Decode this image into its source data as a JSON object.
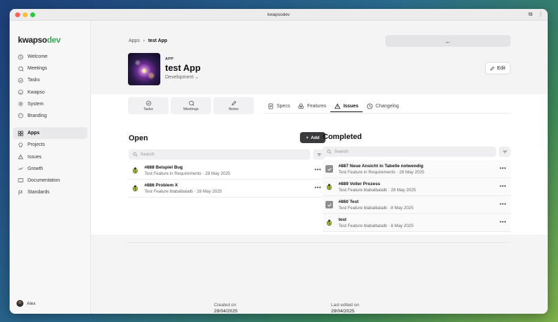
{
  "window": {
    "title": "kwapsodev"
  },
  "brand": {
    "part1": "kwapso",
    "part2": "dev",
    "accent": "#3aa757"
  },
  "sidebar": {
    "items": [
      {
        "label": "Welcome",
        "icon": "home-icon"
      },
      {
        "label": "Meetings",
        "icon": "chat-icon"
      },
      {
        "label": "Tasks",
        "icon": "check-circle-icon"
      },
      {
        "label": "Kwapso",
        "icon": "smile-icon"
      },
      {
        "label": "System",
        "icon": "gear-icon"
      },
      {
        "label": "Branding",
        "icon": "palette-icon"
      },
      {
        "label": "Apps",
        "icon": "grid-icon",
        "active": true
      },
      {
        "label": "Projects",
        "icon": "bulb-icon"
      },
      {
        "label": "Issues",
        "icon": "warning-icon"
      },
      {
        "label": "Growth",
        "icon": "trend-icon"
      },
      {
        "label": "Documentation",
        "icon": "book-icon"
      },
      {
        "label": "Standards",
        "icon": "flag-icon"
      }
    ],
    "user": "Alex"
  },
  "breadcrumb": {
    "root": "Apps",
    "current": "test App"
  },
  "app": {
    "kicker": "APP",
    "name": "test App",
    "environment": "Development"
  },
  "edit_label": "Edit",
  "quick_links": [
    "Tasks",
    "Meetings",
    "Notes"
  ],
  "tabs": [
    {
      "label": "Specs"
    },
    {
      "label": "Features"
    },
    {
      "label": "Issues",
      "active": true
    },
    {
      "label": "Changelog"
    }
  ],
  "open": {
    "title": "Open",
    "add_label": "Add",
    "search_placeholder": "Search",
    "issues": [
      {
        "title": "#888 Beispiel Bug",
        "sub": "Test Feature in Requirements · 28 May 2025"
      },
      {
        "title": "#886 Problem X",
        "sub": "Test Feature blabalbalalb · 28 May 2025"
      }
    ]
  },
  "completed": {
    "title": "Completed",
    "search_placeholder": "Search",
    "issues": [
      {
        "title": "#887 Neue Ansicht in Tabelle notwendig",
        "sub": "Test Feature in Requirements · 28 May 2025",
        "checked": true
      },
      {
        "title": "#889 Voller Prozess",
        "sub": "Test Feature blabalbalalb · 28 May 2025",
        "checked": false
      },
      {
        "title": "#860 Test",
        "sub": "Test Feature blabalbalalb · 8 May 2025",
        "checked": true
      },
      {
        "title": "test",
        "sub": "Test Feature blabalbalalb · 8 May 2025",
        "checked": false
      }
    ]
  },
  "meta": {
    "created_label": "Created on",
    "created_value": "29/04/2025",
    "edited_label": "Last edited on",
    "edited_value": "29/04/2025"
  }
}
